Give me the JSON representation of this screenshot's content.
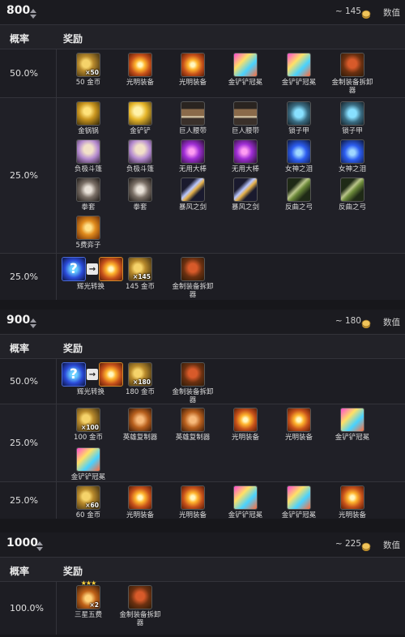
{
  "labels": {
    "prob": "概率",
    "reward": "奖励",
    "value": "数值"
  },
  "sections": [
    {
      "title": "800",
      "value": "~ 145",
      "rows": [
        {
          "prob": "50.0%",
          "items": [
            {
              "name": "50 金币",
              "icon": "coins",
              "qty": "×50"
            },
            {
              "name": "光明装备",
              "icon": "radiant"
            },
            {
              "name": "光明装备",
              "icon": "radiant"
            },
            {
              "name": "金铲铲冠冕",
              "icon": "crown"
            },
            {
              "name": "金铲铲冠冕",
              "icon": "crown"
            },
            {
              "name": "金制装备拆卸器",
              "icon": "remover"
            }
          ]
        },
        {
          "prob": "25.0%",
          "items": [
            {
              "name": "金锅锅",
              "icon": "pan"
            },
            {
              "name": "金铲铲",
              "icon": "spatula"
            },
            {
              "name": "巨人腰带",
              "icon": "belt"
            },
            {
              "name": "巨人腰带",
              "icon": "belt"
            },
            {
              "name": "锁子甲",
              "icon": "chain"
            },
            {
              "name": "锁子甲",
              "icon": "chain"
            },
            {
              "name": "负极斗篷",
              "icon": "cloak"
            },
            {
              "name": "负极斗篷",
              "icon": "cloak"
            },
            {
              "name": "无用大棒",
              "icon": "rod"
            },
            {
              "name": "无用大棒",
              "icon": "rod"
            },
            {
              "name": "女神之泪",
              "icon": "tear"
            },
            {
              "name": "女神之泪",
              "icon": "tear"
            },
            {
              "name": "拳套",
              "icon": "glove"
            },
            {
              "name": "拳套",
              "icon": "glove"
            },
            {
              "name": "暴风之剑",
              "icon": "sword"
            },
            {
              "name": "暴风之剑",
              "icon": "sword"
            },
            {
              "name": "反曲之弓",
              "icon": "bow"
            },
            {
              "name": "反曲之弓",
              "icon": "bow"
            },
            {
              "name": "5费弈子",
              "icon": "fivecost"
            }
          ]
        },
        {
          "prob": "25.0%",
          "items": [
            {
              "name": "辉光转换",
              "icon": "transform"
            },
            {
              "name": "145 金币",
              "icon": "coins",
              "qty": "×145"
            },
            {
              "name": "金制装备拆卸器",
              "icon": "remover"
            }
          ]
        }
      ]
    },
    {
      "title": "900",
      "value": "~ 180",
      "rows": [
        {
          "prob": "50.0%",
          "items": [
            {
              "name": "辉光转换",
              "icon": "transform"
            },
            {
              "name": "180 金币",
              "icon": "coins",
              "qty": "×180"
            },
            {
              "name": "金制装备拆卸器",
              "icon": "remover"
            }
          ]
        },
        {
          "prob": "25.0%",
          "items": [
            {
              "name": "100 金币",
              "icon": "coins",
              "qty": "×100"
            },
            {
              "name": "英雄复制器",
              "icon": "hero"
            },
            {
              "name": "英雄复制器",
              "icon": "hero"
            },
            {
              "name": "光明装备",
              "icon": "radiant"
            },
            {
              "name": "光明装备",
              "icon": "radiant"
            },
            {
              "name": "金铲铲冠冕",
              "icon": "crown"
            },
            {
              "name": "金铲铲冠冕",
              "icon": "crown"
            }
          ]
        },
        {
          "prob": "25.0%",
          "items": [
            {
              "name": "60 金币",
              "icon": "coins",
              "qty": "×60"
            },
            {
              "name": "光明装备",
              "icon": "radiant"
            },
            {
              "name": "光明装备",
              "icon": "radiant"
            },
            {
              "name": "金铲铲冠冕",
              "icon": "crown"
            },
            {
              "name": "金铲铲冠冕",
              "icon": "crown"
            },
            {
              "name": "光明装备",
              "icon": "radiant"
            }
          ]
        }
      ]
    },
    {
      "title": "1000",
      "value": "~ 225",
      "rows": [
        {
          "prob": "100.0%",
          "items": [
            {
              "name": "三星五费",
              "icon": "threestar",
              "qty": "×2"
            },
            {
              "name": "金制装备拆卸器",
              "icon": "remover"
            }
          ]
        }
      ]
    }
  ]
}
